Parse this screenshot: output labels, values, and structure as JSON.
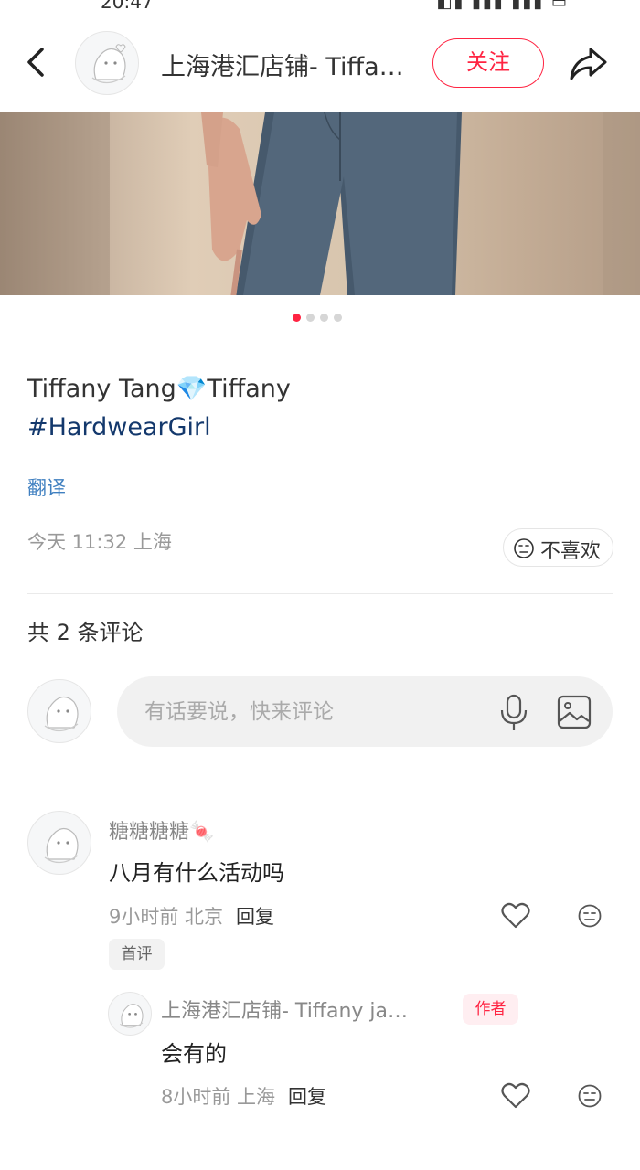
{
  "status_bar": {
    "time": "20:47",
    "icons": "◧▮ ▮▮▮ ▮▮▮ ▭"
  },
  "header": {
    "title": "上海港汇店铺- Tiffany ja…",
    "follow_label": "关注",
    "back_icon": "chevron-left-icon",
    "share_icon": "share-arrow-icon"
  },
  "carousel": {
    "total": 4,
    "active_index": 0
  },
  "post": {
    "caption_line1": "Tiffany Tang💎Tiffany",
    "hashtag": "#HardwearGirl",
    "translate_label": "翻译",
    "meta": "今天 11:32 上海",
    "dislike_label": "不喜欢"
  },
  "comments_section": {
    "count_label": "共 2 条评论",
    "input_placeholder": "有话要说，快来评论",
    "comments": [
      {
        "username": "糖糖糖糖🍬",
        "text": "八月有什么活动吗",
        "time_location": "9小时前 北京",
        "reply_label": "回复",
        "tag": "首评"
      },
      {
        "username": "上海港汇店铺- Tiffany ja…",
        "badge": "作者",
        "text": "会有的",
        "time_location": "8小时前 上海",
        "reply_label": "回复"
      }
    ]
  },
  "colors": {
    "accent": "#ff2442",
    "hashtag": "#13386c",
    "link": "#3f7fc0",
    "muted_text": "#999999"
  }
}
